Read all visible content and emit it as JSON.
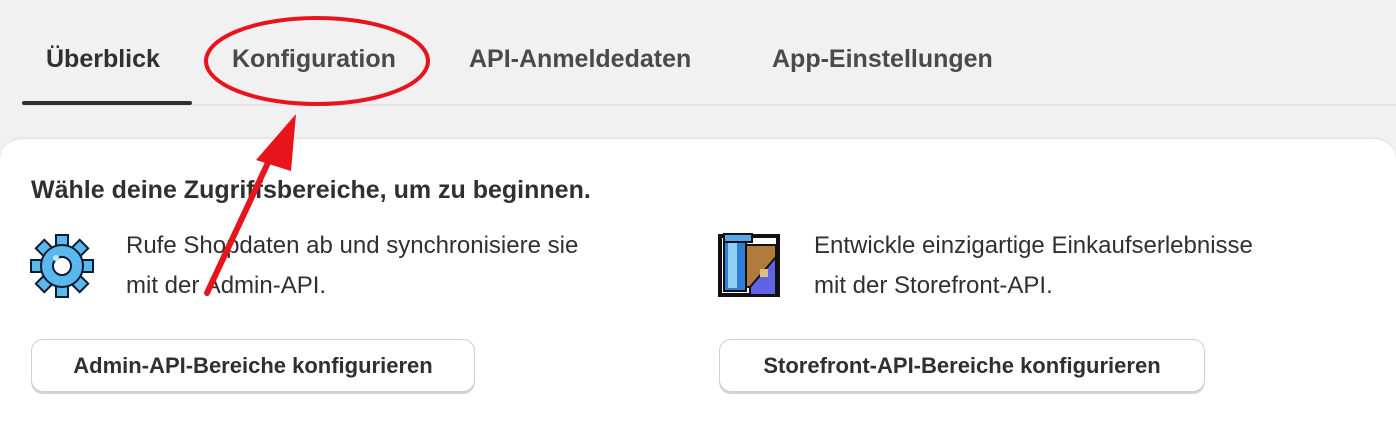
{
  "tabs": [
    {
      "label": "Überblick",
      "active": true
    },
    {
      "label": "Konfiguration",
      "active": false
    },
    {
      "label": "API-Anmeldedaten",
      "active": false
    },
    {
      "label": "App-Einstellungen",
      "active": false
    }
  ],
  "card": {
    "title": "Wähle deine Zugriffsbereiche, um zu beginnen.",
    "admin": {
      "icon": "gear-icon",
      "line1": "Rufe Shopdaten ab und synchronisiere sie",
      "line2": "mit der Admin-API.",
      "button": "Admin-API-Bereiche konfigurieren"
    },
    "storefront": {
      "icon": "storefront-icon",
      "line1": "Entwickle einzigartige Einkaufserlebnisse",
      "line2": "mit der Storefront-API.",
      "button": "Storefront-API-Bereiche konfigurieren"
    }
  },
  "annotation": {
    "highlight_color": "#e8141c",
    "target": "Konfiguration"
  }
}
